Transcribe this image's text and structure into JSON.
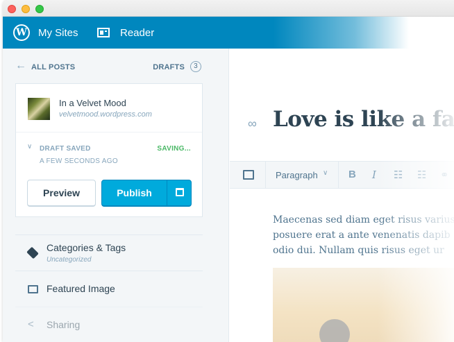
{
  "window": {
    "controls": [
      "close",
      "minimize",
      "maximize"
    ]
  },
  "masterbar": {
    "my_sites_label": "My Sites",
    "reader_label": "Reader",
    "logo_glyph": "W",
    "accent_color": "#0087be"
  },
  "sidebar": {
    "back_label": "ALL POSTS",
    "drafts_label": "DRAFTS",
    "drafts_count": "3",
    "site": {
      "name": "In a Velvet Mood",
      "url": "velvetmood.wordpress.com"
    },
    "status": {
      "label": "DRAFT SAVED",
      "time": "A FEW SECONDS AGO",
      "saving": "SAVING..."
    },
    "buttons": {
      "preview": "Preview",
      "publish": "Publish"
    },
    "items": [
      {
        "label": "Categories & Tags",
        "sublabel": "Uncategorized",
        "icon": "tag-icon"
      },
      {
        "label": "Featured Image",
        "icon": "image-icon"
      },
      {
        "label": "Sharing",
        "icon": "share-icon"
      }
    ]
  },
  "editor": {
    "title": "Love is like a fau",
    "toolbar": {
      "format": "Paragraph",
      "bold": "B",
      "italic": "I",
      "bullet_list": "☷",
      "numbered_list": "☷",
      "link": "🔗"
    },
    "body_lines": [
      "Maecenas sed diam eget risus varius",
      "posuere erat a ante venenatis dapib",
      "odio dui. Nullam quis risus eget ur"
    ]
  }
}
